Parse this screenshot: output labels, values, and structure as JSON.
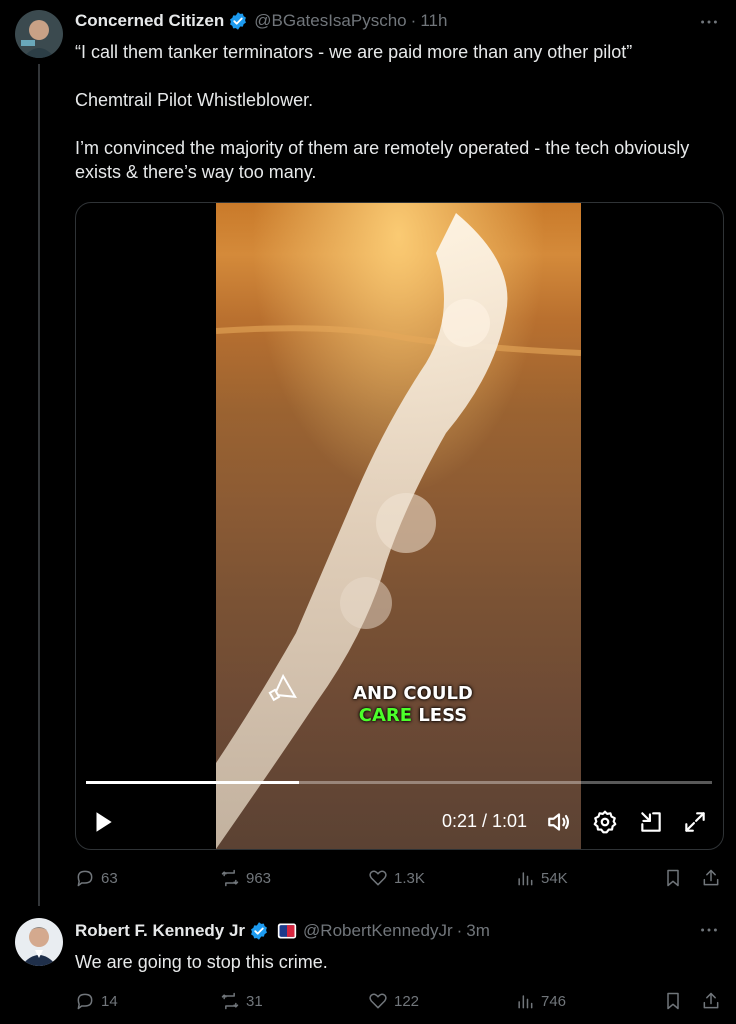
{
  "tweet1": {
    "name": "Concerned Citizen",
    "handle": "@BGatesIsaPyscho",
    "separator": "·",
    "time": "11h",
    "text_lines": [
      "“I call them tanker terminators - we are paid more than any other pilot”",
      "Chemtrail Pilot Whistleblower.",
      "I’m convinced the majority of them are remotely operated - the tech obviously exists & there’s way too many."
    ],
    "video": {
      "caption_line1": "AND COULD",
      "caption_highlight": "CARE",
      "caption_rest": " LESS",
      "time_display": "0:21 / 1:01",
      "progress_fraction": 0.34
    },
    "stats": {
      "replies": "63",
      "reposts": "963",
      "likes": "1.3K",
      "views": "54K"
    }
  },
  "tweet2": {
    "name": "Robert F. Kennedy Jr",
    "handle": "@RobertKennedyJr",
    "separator": "·",
    "time": "3m",
    "text": "We are going to stop this crime.",
    "stats": {
      "replies": "14",
      "reposts": "31",
      "likes": "122",
      "views": "746"
    }
  },
  "colors": {
    "background": "#000000",
    "text": "#e7e9ea",
    "muted": "#71767b",
    "verified": "#1d9bf0",
    "caption_highlight": "#4cff2a"
  }
}
